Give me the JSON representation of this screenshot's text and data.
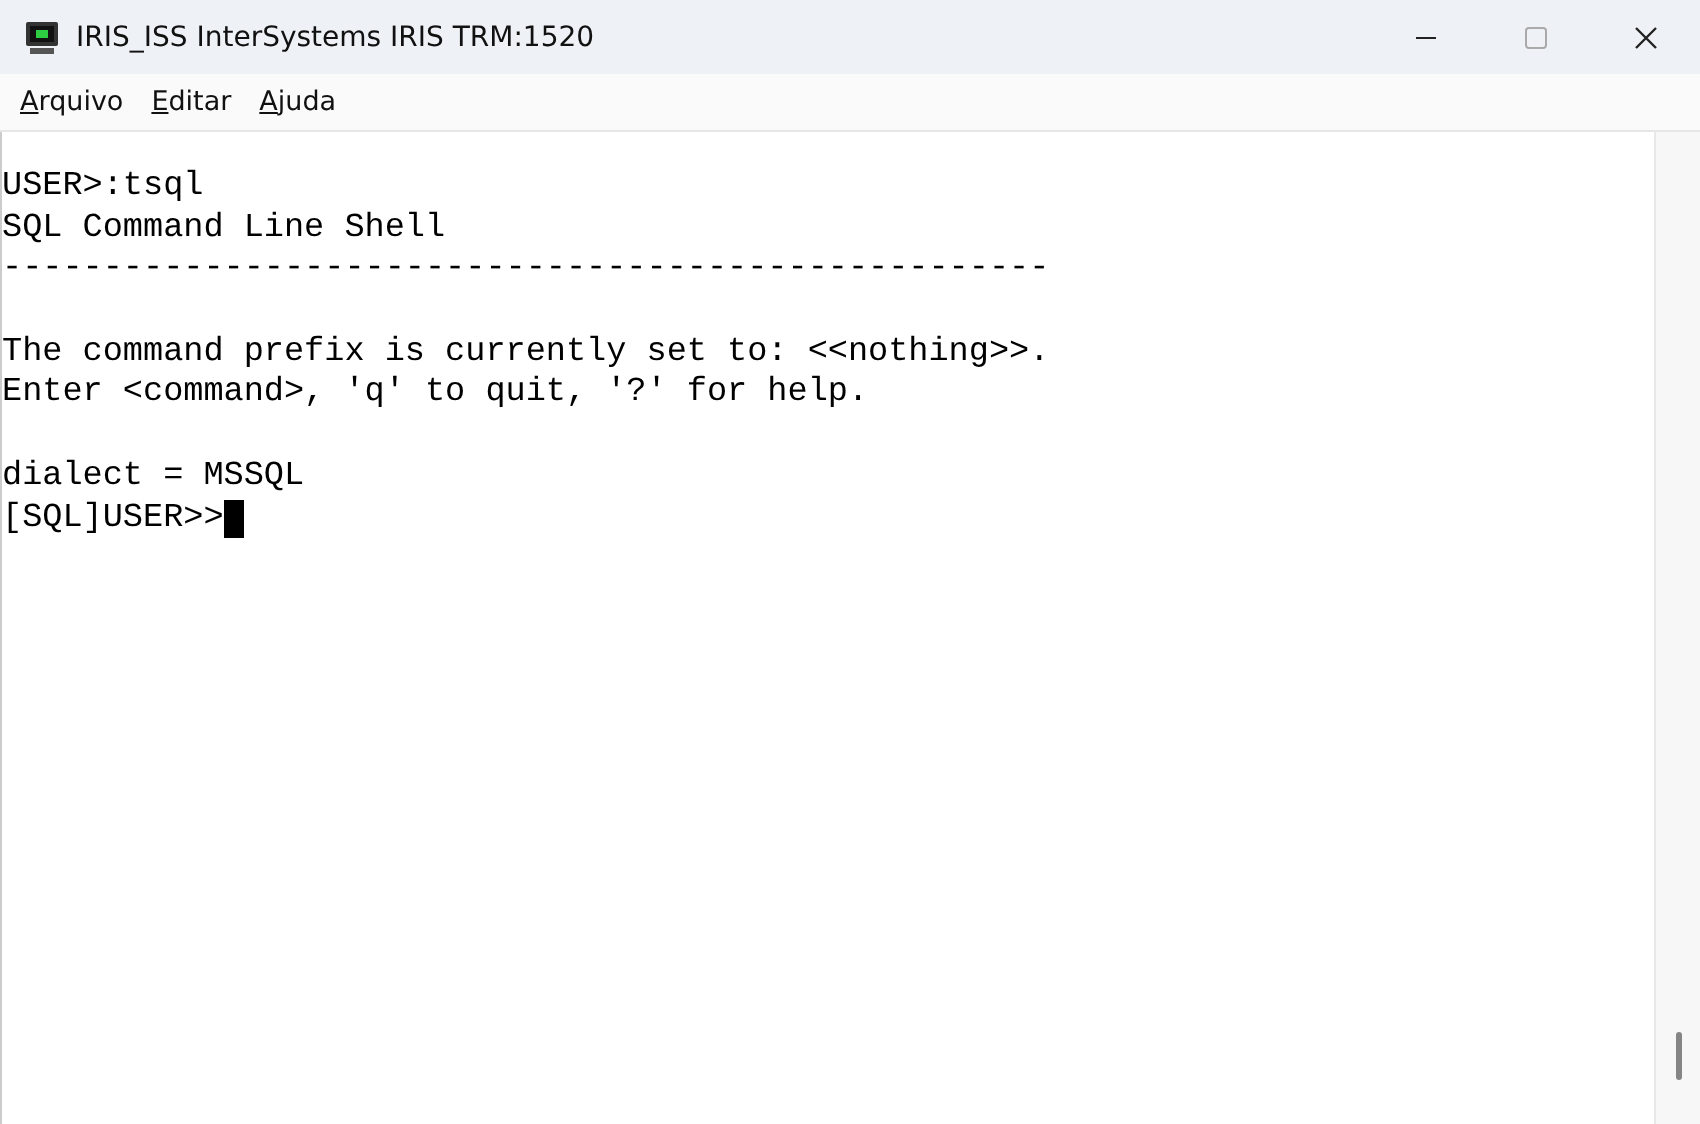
{
  "window": {
    "title": "IRIS_ISS InterSystems IRIS TRM:1520"
  },
  "menu": [
    {
      "label": "Arquivo"
    },
    {
      "label": "Editar"
    },
    {
      "label": "Ajuda"
    }
  ],
  "terminal": {
    "blocks": [
      [
        "USER>:tsql",
        "SQL Command Line Shell",
        "----------------------------------------------------"
      ],
      [
        "The command prefix is currently set to: <<nothing>>.",
        "Enter <command>, 'q' to quit, '?' for help."
      ],
      [
        "dialect = MSSQL",
        "[SQL]USER>>"
      ]
    ],
    "cursor": true
  }
}
